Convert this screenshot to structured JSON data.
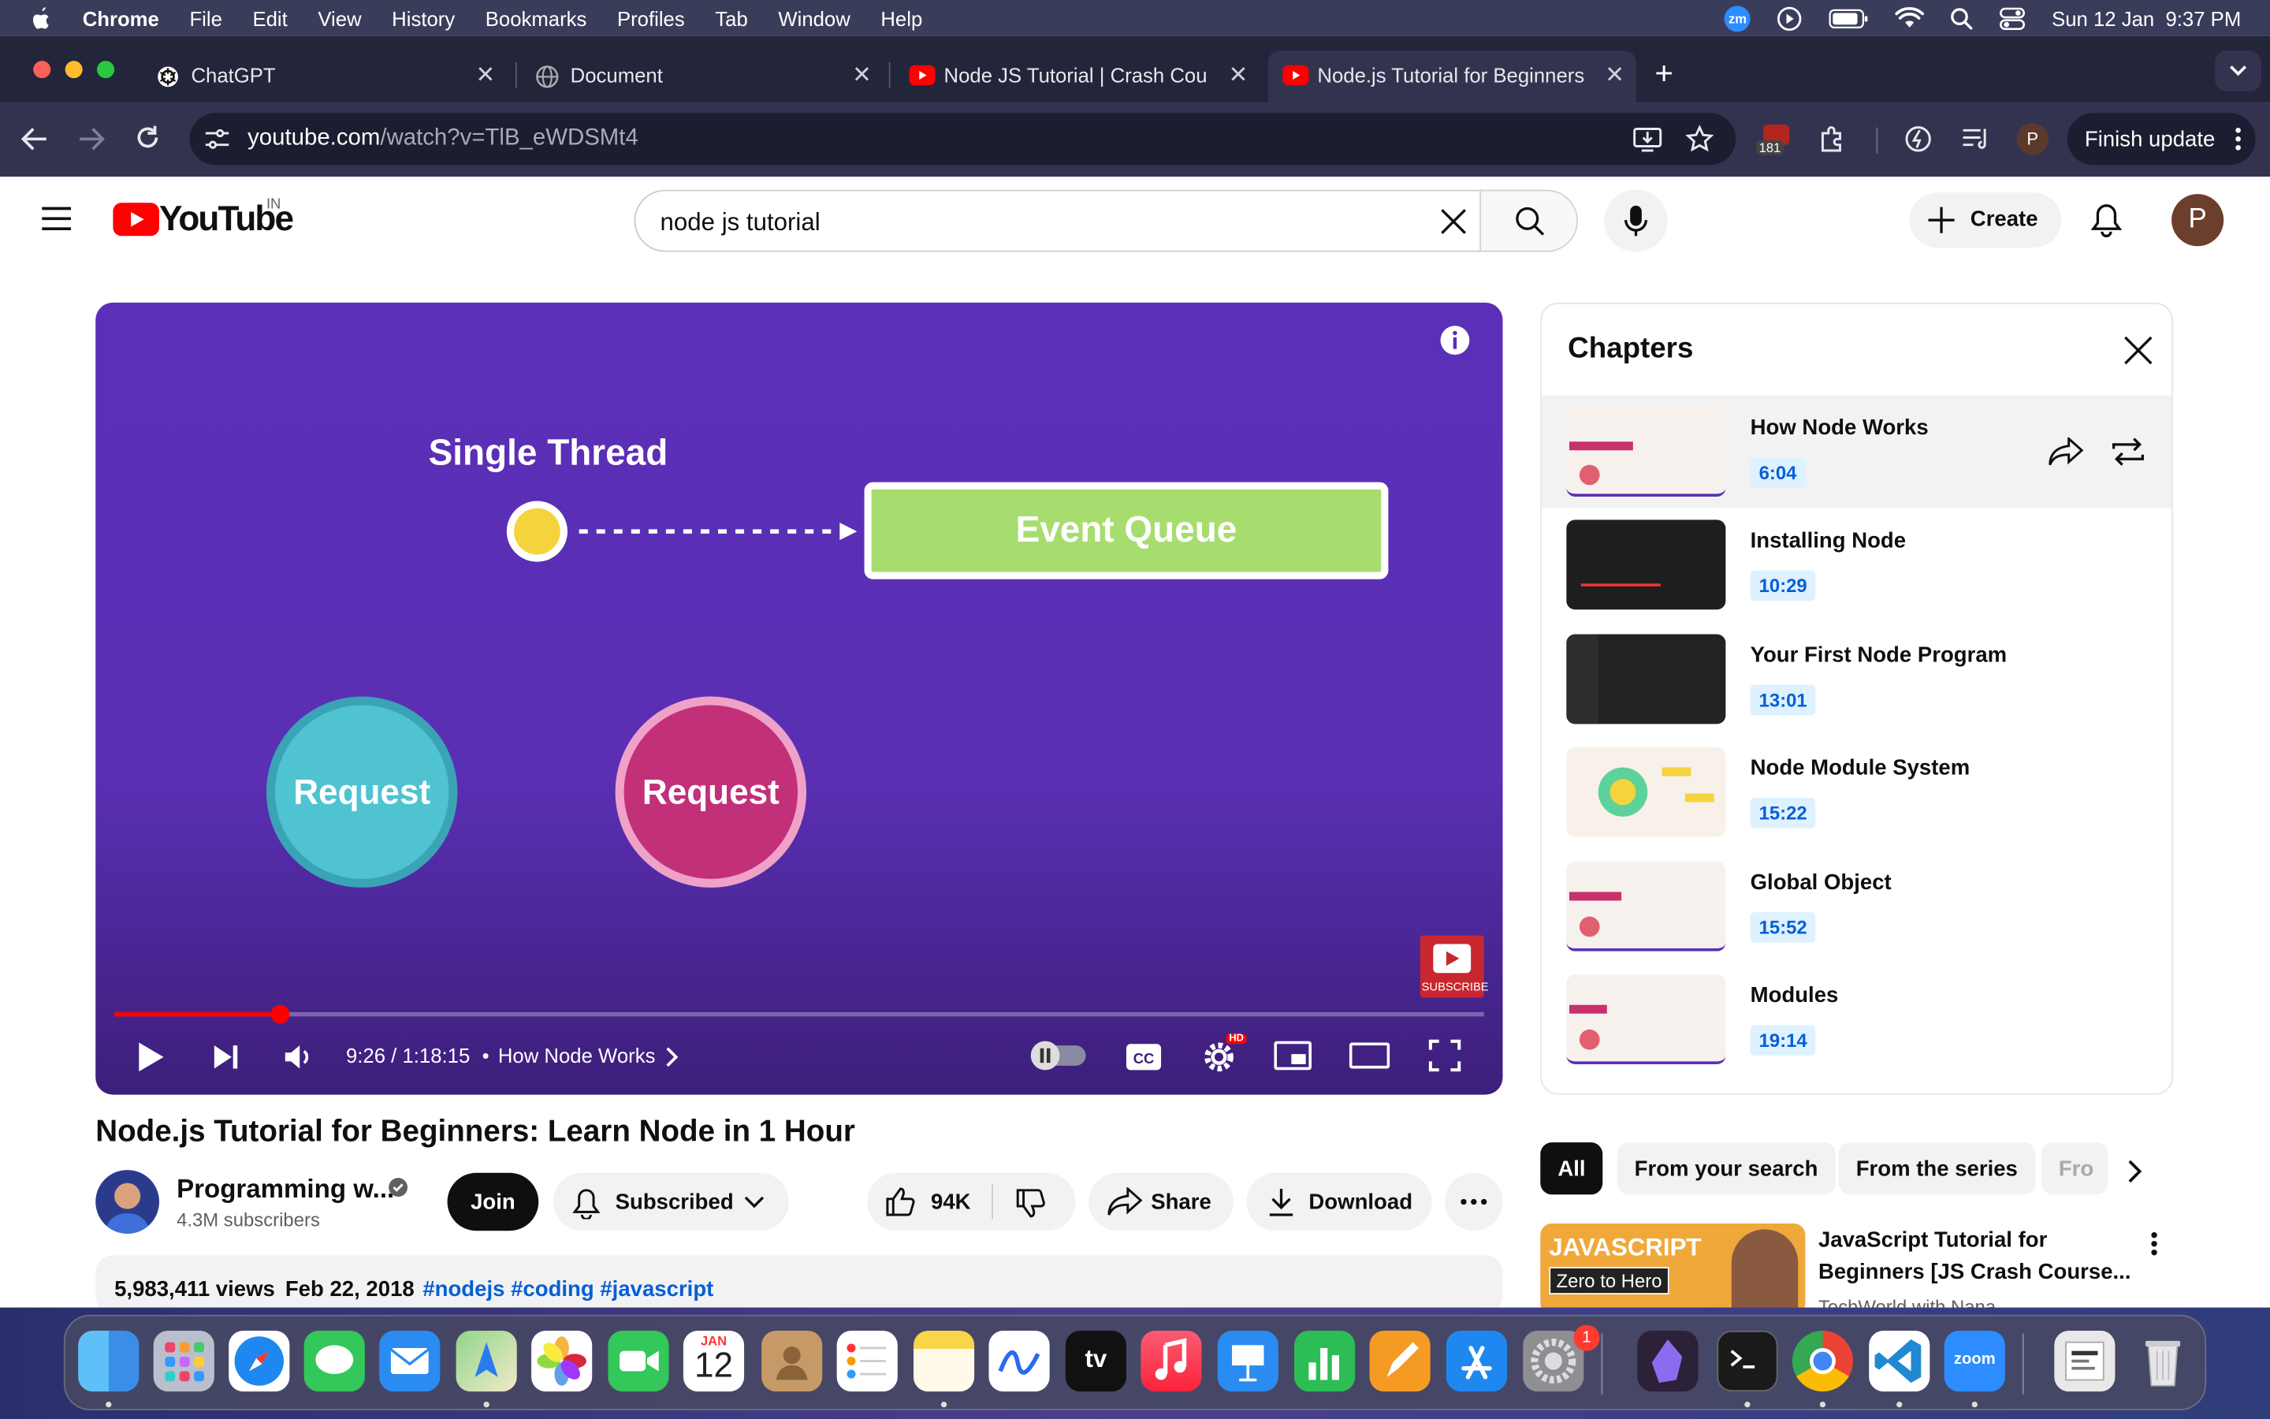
{
  "menubar": {
    "app": "Chrome",
    "items": [
      "File",
      "Edit",
      "View",
      "History",
      "Bookmarks",
      "Profiles",
      "Tab",
      "Window",
      "Help"
    ],
    "zoom_badge": "zm",
    "datetime": "Sun 12 Jan  9:37 PM"
  },
  "tabs": [
    {
      "title": "ChatGPT",
      "icon": "openai-icon"
    },
    {
      "title": "Document",
      "icon": "globe-icon"
    },
    {
      "title": "Node JS Tutorial | Crash Cour",
      "icon": "youtube-icon"
    },
    {
      "title": "Node.js Tutorial for Beginners",
      "icon": "youtube-icon",
      "active": true
    }
  ],
  "toolbar": {
    "url_host": "youtube.com",
    "url_path": "/watch?v=TlB_eWDSMt4",
    "extension_badge": "181",
    "profile_initial": "P",
    "finish_update": "Finish update"
  },
  "youtube": {
    "logo_text": "YouTube",
    "region": "IN",
    "search_value": "node js tutorial",
    "create_label": "Create",
    "avatar_initial": "P"
  },
  "video": {
    "slide_title": "Single Thread",
    "event_queue": "Event Queue",
    "request_1": "Request",
    "request_2": "Request",
    "subscribe_label": "SUBSCRIBE",
    "time": "9:26 / 1:18:15",
    "chapter_sep": "•",
    "chapter": "How Node Works",
    "progress_fraction": 0.12,
    "hd_badge": "HD"
  },
  "chapters": {
    "heading": "Chapters",
    "items": [
      {
        "title": "How Node Works",
        "time": "6:04",
        "active": true
      },
      {
        "title": "Installing Node",
        "time": "10:29"
      },
      {
        "title": "Your First Node Program",
        "time": "13:01"
      },
      {
        "title": "Node Module System",
        "time": "15:22"
      },
      {
        "title": "Global Object",
        "time": "15:52"
      },
      {
        "title": "Modules",
        "time": "19:14"
      }
    ]
  },
  "meta": {
    "title": "Node.js Tutorial for Beginners: Learn Node in 1 Hour",
    "channel": "Programming w...",
    "subscribers": "4.3M subscribers",
    "join": "Join",
    "subscribed": "Subscribed",
    "likes": "94K",
    "share": "Share",
    "download": "Download",
    "views": "5,983,411 views",
    "date": "Feb 22, 2018",
    "hashtags": "#nodejs #coding #javascript"
  },
  "chips": [
    "All",
    "From your search",
    "From the series",
    "Fro"
  ],
  "recommendation": {
    "thumb_heading": "JAVASCRIPT",
    "thumb_sub": "Zero to Hero",
    "title_line1": "JavaScript Tutorial for",
    "title_line2": "Beginners [JS Crash Course...",
    "channel": "TechWorld with Nana"
  },
  "dock": {
    "calendar_month": "JAN",
    "calendar_day": "12",
    "tv_label": "tv",
    "settings_badge": "1",
    "zoom_label": "zoom"
  },
  "colors": {
    "youtube_red": "#ff0000",
    "menubar": "#3a3d5a",
    "tabstrip": "#23253b",
    "toolbar": "#32344f",
    "video_bg": "#5b2fb8",
    "event_queue": "#a7dd6e",
    "request_teal": "#4fc3d0",
    "request_pink": "#c2307a",
    "chapter_time": "#065fd4"
  }
}
